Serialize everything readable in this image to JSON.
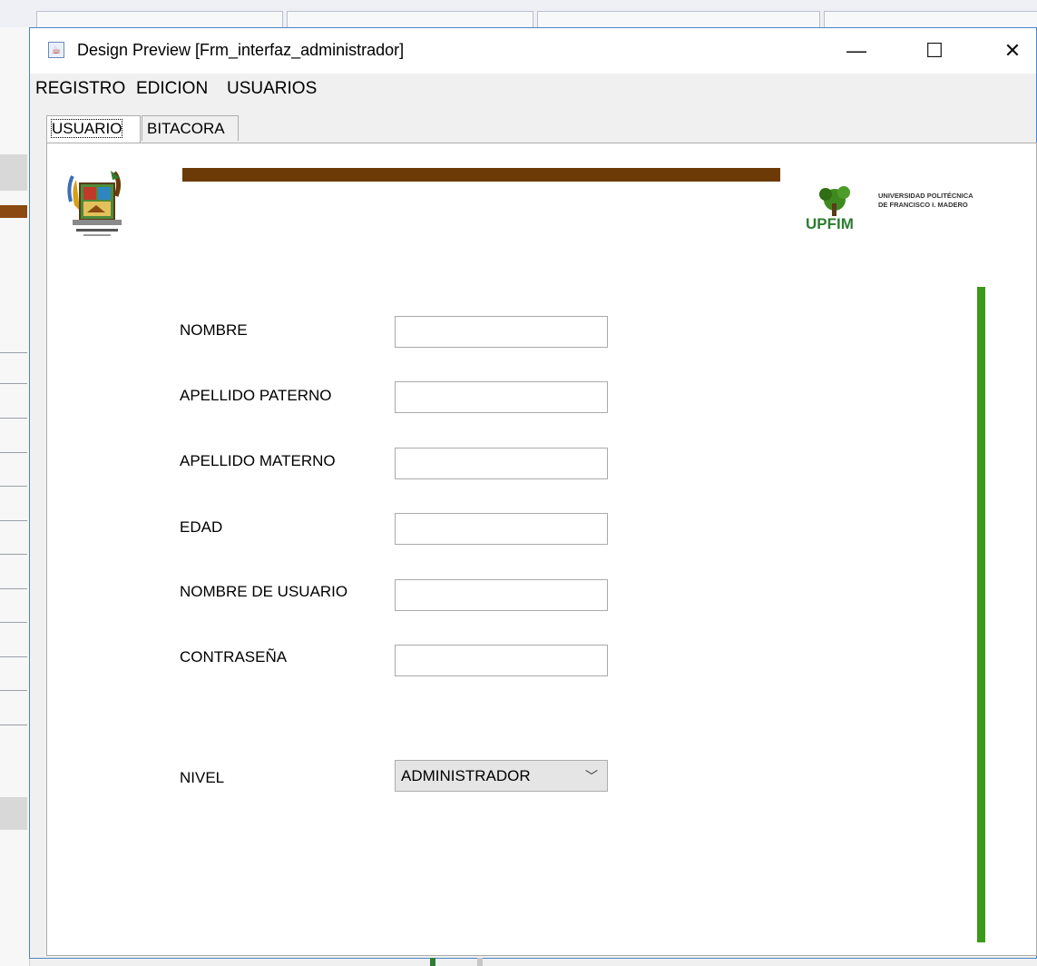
{
  "window": {
    "title": "Design Preview [Frm_interfaz_administrador]",
    "minimize_glyph": "—",
    "maximize_glyph": "☐",
    "close_glyph": "✕"
  },
  "menubar": {
    "items": [
      "REGISTRO",
      "EDICION",
      "USUARIOS"
    ]
  },
  "tabs": [
    {
      "label": "USUARIO",
      "active": true
    },
    {
      "label": "BITACORA",
      "active": false
    }
  ],
  "logos": {
    "right_line1": "UNIVERSIDAD POLITÉCNICA",
    "right_line2": "DE FRANCISCO I. MADERO",
    "right_mark": "UPFIM"
  },
  "form": {
    "fields": [
      {
        "label": "NOMBRE",
        "value": ""
      },
      {
        "label": "APELLIDO PATERNO",
        "value": ""
      },
      {
        "label": "APELLIDO MATERNO",
        "value": ""
      },
      {
        "label": "EDAD",
        "value": ""
      },
      {
        "label": "NOMBRE DE USUARIO",
        "value": ""
      },
      {
        "label": "CONTRASEÑA",
        "value": ""
      }
    ],
    "nivel": {
      "label": "NIVEL",
      "selected": "ADMINISTRADOR"
    }
  },
  "colors": {
    "brown_bar": "#6b3a07",
    "green_bar": "#3a9a1a",
    "window_border": "#4a86c8"
  }
}
